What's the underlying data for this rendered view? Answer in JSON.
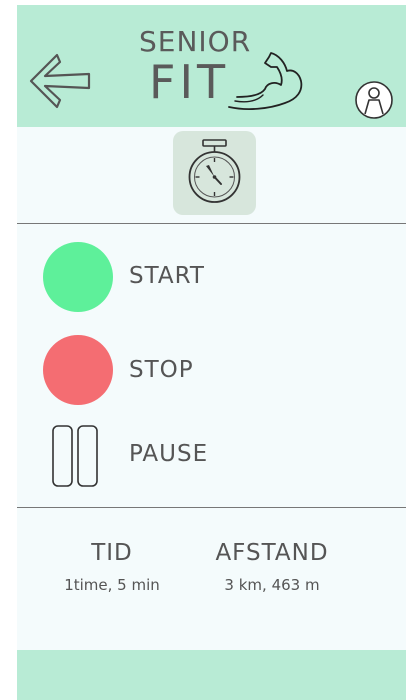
{
  "header": {
    "logo_top": "SENIOR",
    "logo_bottom": "FIT",
    "back_icon": "arrow-left-icon",
    "profile_icon": "person-icon",
    "arm_icon": "flexed-arm-icon"
  },
  "timer": {
    "icon": "stopwatch-icon"
  },
  "controls": [
    {
      "label": "START",
      "color": "#5ef09a"
    },
    {
      "label": "STOP",
      "color": "#f46d72"
    },
    {
      "label": "PAUSE",
      "icon": "pause-icon"
    }
  ],
  "stats": {
    "time_label": "TID",
    "time_value": "1time, 5 min",
    "distance_label": "AFSTAND",
    "distance_value": "3 km, 463 m"
  },
  "colors": {
    "header_bg": "#b8ebd5",
    "content_bg": "#f4fbfc",
    "tile_bg": "#d7e6dc"
  }
}
